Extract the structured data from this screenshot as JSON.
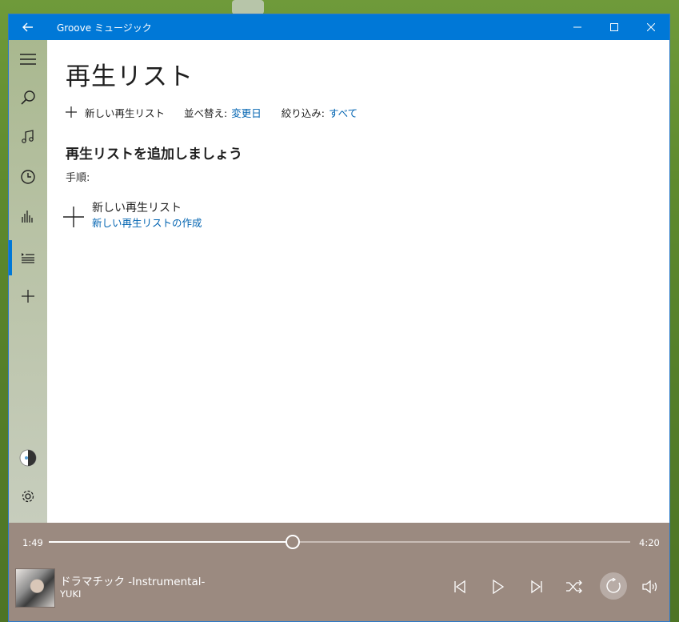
{
  "titlebar": {
    "app_title": "Groove ミュージック",
    "back_icon": "back-arrow-icon",
    "minimize_icon": "minimize-icon",
    "maximize_icon": "maximize-icon",
    "close_icon": "close-icon",
    "color": "#0078d7"
  },
  "sidebar": {
    "items": [
      {
        "icon": "hamburger-menu-icon"
      },
      {
        "icon": "search-icon"
      },
      {
        "icon": "music-note-icon"
      },
      {
        "icon": "recent-clock-icon"
      },
      {
        "icon": "now-playing-bars-icon"
      },
      {
        "icon": "playlist-icon",
        "active": true
      },
      {
        "icon": "plus-icon"
      }
    ],
    "bottom": [
      {
        "icon": "account-avatar-icon"
      },
      {
        "icon": "settings-gear-icon"
      }
    ]
  },
  "main": {
    "title": "再生リスト",
    "commands": {
      "new_playlist": "新しい再生リスト",
      "sort_label": "並べ替え:",
      "sort_value": "変更日",
      "filter_label": "絞り込み:",
      "filter_value": "すべて"
    },
    "heading": "再生リストを追加しましょう",
    "steps_label": "手順:",
    "new_playlist_card": {
      "title": "新しい再生リスト",
      "subtitle": "新しい再生リストの作成"
    }
  },
  "player": {
    "current_time": "1:49",
    "total_time": "4:20",
    "progress": 0.42,
    "track_title": "ドラマチック -Instrumental-",
    "artist": "YUKI",
    "controls": [
      "previous-icon",
      "play-icon",
      "next-icon",
      "shuffle-icon",
      "repeat-icon",
      "volume-icon"
    ],
    "background": "#9b8a80",
    "accent": "#0063b1"
  }
}
